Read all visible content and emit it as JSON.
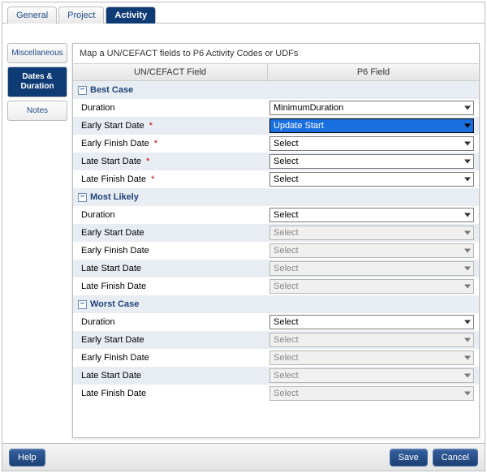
{
  "top_tabs": {
    "general": "General",
    "project": "Project",
    "activity": "Activity"
  },
  "side_tabs": {
    "miscellaneous": "Miscellaneous",
    "dates_duration_line1": "Dates &",
    "dates_duration_line2": "Duration",
    "notes": "Notes"
  },
  "panel_title": "Map a UN/CEFACT fields to P6 Activity Codes or UDFs",
  "headers": {
    "col1": "UN/CEFACT Field",
    "col2": "P6 Field"
  },
  "groups": {
    "best_case": "Best Case",
    "most_likely": "Most Likely",
    "worst_case": "Worst Case"
  },
  "labels": {
    "duration": "Duration",
    "early_start": "Early Start Date",
    "early_finish": "Early Finish Date",
    "late_start": "Late Start Date",
    "late_finish": "Late Finish Date"
  },
  "values": {
    "minimum_duration": "MinimumDuration",
    "update_start": "Update Start",
    "select": "Select"
  },
  "footer": {
    "help": "Help",
    "save": "Save",
    "cancel": "Cancel"
  },
  "required_marker": "*",
  "collapse_glyph": "−"
}
